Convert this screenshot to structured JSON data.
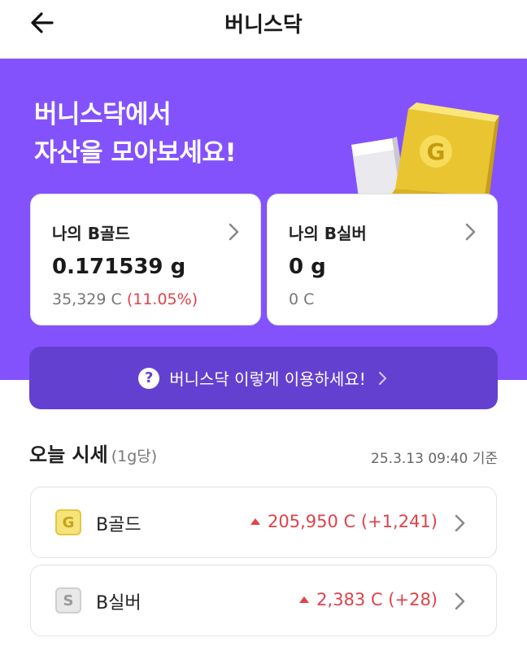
{
  "header": {
    "title": "버니스닥"
  },
  "hero": {
    "line1": "버니스닥에서",
    "line2": "자산을 모아보세요!"
  },
  "cards": {
    "gold": {
      "label": "나의 B골드",
      "value": "0.171539 g",
      "sub": "35,329 C",
      "pct": "(11.05%)"
    },
    "silver": {
      "label": "나의 B실버",
      "value": "0 g",
      "sub": "0 C"
    }
  },
  "guide_button": {
    "label": "버니스닥 이렇게 이용하세요!"
  },
  "market": {
    "title": "오늘 시세",
    "unit": "(1g당)",
    "timestamp": "25.3.13 09:40 기준",
    "rows": [
      {
        "coin": "G",
        "name": "B골드",
        "price": "205,950 C (+1,241)"
      },
      {
        "coin": "S",
        "name": "B실버",
        "price": "2,383 C (+28)"
      }
    ]
  },
  "colors": {
    "hero": "#8352fd",
    "button": "#6440d1",
    "up": "#e0424a"
  },
  "icons": [
    "arrow-left-icon",
    "chevron-right-icon",
    "question-icon",
    "triangle-up-icon"
  ]
}
